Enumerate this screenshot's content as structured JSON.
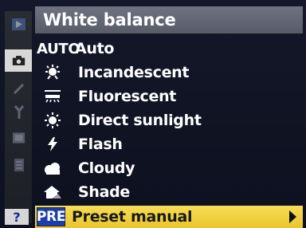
{
  "menu_title": "White balance",
  "items": [
    {
      "code": "AUTO",
      "label": "Auto",
      "icon": "auto-text"
    },
    {
      "label": "Incandescent",
      "icon": "incandescent-icon"
    },
    {
      "label": "Fluorescent",
      "icon": "fluorescent-icon"
    },
    {
      "label": "Direct sunlight",
      "icon": "sun-icon"
    },
    {
      "label": "Flash",
      "icon": "flash-icon"
    },
    {
      "label": "Cloudy",
      "icon": "cloud-icon"
    },
    {
      "label": "Shade",
      "icon": "shade-icon"
    },
    {
      "code": "PRE",
      "label": "Preset manual",
      "icon": "preset-text",
      "selected": true
    }
  ],
  "help_label": "?",
  "colors": {
    "selection": "#f0d040",
    "header": "#646775",
    "code_badge": "#1e3fa8"
  }
}
